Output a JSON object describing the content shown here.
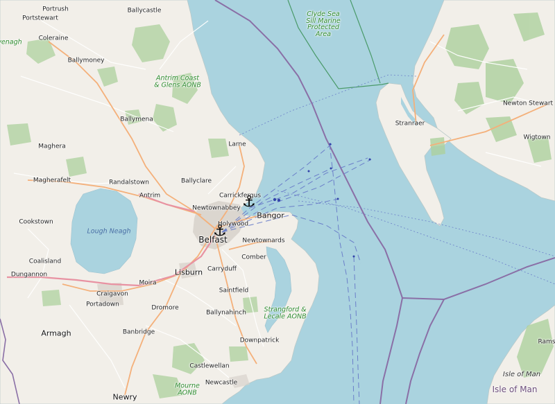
{
  "map": {
    "colors": {
      "sea": "#aad3df",
      "land": "#f2efe9",
      "woodland": "#add19e",
      "urban": "#d8d3cc",
      "primary_road": "#f4b07a",
      "minor_road": "#ffffff",
      "ferry_route": "#6b7fc9",
      "maritime_boundary": "#8a6fa6",
      "protected_area": "#4a9a6a"
    },
    "towns": [
      {
        "id": "portrush",
        "name": "Portrush"
      },
      {
        "id": "ballycastle",
        "name": "Ballycastle"
      },
      {
        "id": "portstewart",
        "name": "Portstewart"
      },
      {
        "id": "coleraine",
        "name": "Coleraine"
      },
      {
        "id": "ballymoney",
        "name": "Ballymoney"
      },
      {
        "id": "ballymena",
        "name": "Ballymena"
      },
      {
        "id": "larne",
        "name": "Larne"
      },
      {
        "id": "maghera",
        "name": "Maghera"
      },
      {
        "id": "magherafelt",
        "name": "Magherafelt"
      },
      {
        "id": "randalstown",
        "name": "Randalstown"
      },
      {
        "id": "ballyclare",
        "name": "Ballyclare"
      },
      {
        "id": "carrickfergus",
        "name": "Carrickfergus"
      },
      {
        "id": "antrim",
        "name": "Antrim"
      },
      {
        "id": "newtownabbey",
        "name": "Newtownabbey"
      },
      {
        "id": "bangor",
        "name": "Bangor"
      },
      {
        "id": "holywood",
        "name": "Holywood"
      },
      {
        "id": "cookstown",
        "name": "Cookstown"
      },
      {
        "id": "newtownards",
        "name": "Newtownards"
      },
      {
        "id": "coalisland",
        "name": "Coalisland"
      },
      {
        "id": "carryduff",
        "name": "Carryduff"
      },
      {
        "id": "comber",
        "name": "Comber"
      },
      {
        "id": "dungannon",
        "name": "Dungannon"
      },
      {
        "id": "lisburn",
        "name": "Lisburn"
      },
      {
        "id": "craigavon",
        "name": "Craigavon"
      },
      {
        "id": "moira",
        "name": "Moira"
      },
      {
        "id": "portadown",
        "name": "Portadown"
      },
      {
        "id": "saintfield",
        "name": "Saintfield"
      },
      {
        "id": "dromore",
        "name": "Dromore"
      },
      {
        "id": "ballynahinch",
        "name": "Ballynahinch"
      },
      {
        "id": "armagh",
        "name": "Armagh"
      },
      {
        "id": "banbridge",
        "name": "Banbridge"
      },
      {
        "id": "downpatrick",
        "name": "Downpatrick"
      },
      {
        "id": "castlewellan",
        "name": "Castlewellan"
      },
      {
        "id": "newcastle",
        "name": "Newcastle"
      },
      {
        "id": "newry",
        "name": "Newry"
      },
      {
        "id": "stranraer",
        "name": "Stranraer"
      },
      {
        "id": "newton-stewart",
        "name": "Newton Stewart"
      },
      {
        "id": "wigtown",
        "name": "Wigtown"
      },
      {
        "id": "ramsey",
        "name": "Rams"
      }
    ],
    "city": {
      "id": "belfast",
      "name": "Belfast"
    },
    "water_labels": [
      {
        "id": "lough-neagh",
        "name": "Lough Neagh"
      }
    ],
    "protected_areas": [
      {
        "id": "clyde-sea-sill",
        "name": "Clyde Sea Sill Marine Protected Area"
      },
      {
        "id": "antrim-coast",
        "name": "Antrim Coast & Glens AONB"
      },
      {
        "id": "strangford",
        "name": "Strangford & Lecale AONB"
      },
      {
        "id": "mourne",
        "name": "Mourne AONB"
      },
      {
        "id": "sperrin-partial",
        "name": "venagh"
      }
    ],
    "island_labels": [
      {
        "id": "isle-of-man-green",
        "name": "Isle of Man"
      }
    ],
    "country_labels": [
      {
        "id": "isle-of-man",
        "name": "Isle of Man"
      }
    ],
    "ports": [
      {
        "id": "port-carrickfergus",
        "icon": "anchor-icon"
      },
      {
        "id": "port-belfast",
        "icon": "anchor-icon"
      }
    ]
  }
}
